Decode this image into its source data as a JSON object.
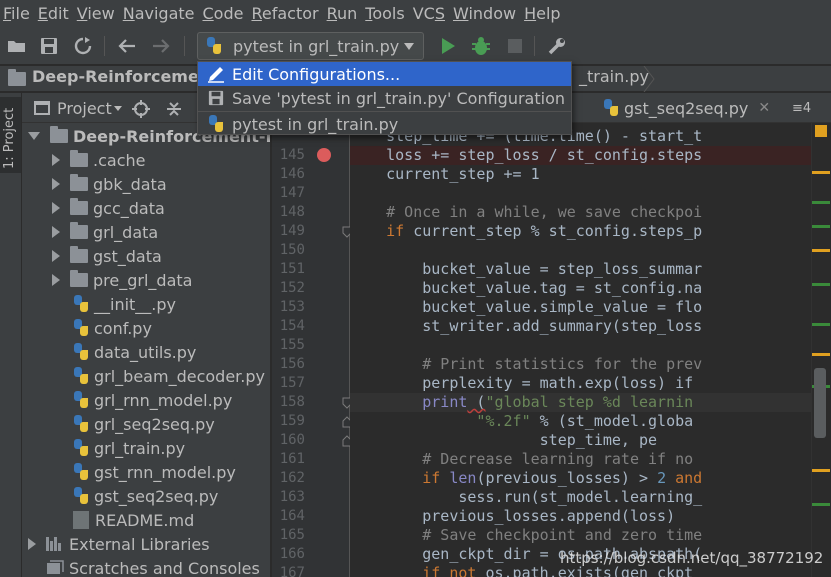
{
  "menubar": {
    "items": [
      "File",
      "Edit",
      "View",
      "Navigate",
      "Code",
      "Refactor",
      "Run",
      "Tools",
      "VCS",
      "Window",
      "Help"
    ],
    "mnemonics": [
      "F",
      "E",
      "V",
      "N",
      "C",
      "R",
      "R",
      "T",
      "S",
      "W",
      "H"
    ]
  },
  "toolbar": {
    "run_config_label": "pytest in grl_train.py",
    "icons": [
      "open-folder-icon",
      "save-icon",
      "sync-icon",
      "back-arrow-icon",
      "forward-arrow-icon",
      "run-icon",
      "debug-icon",
      "stop-icon",
      "wrench-icon"
    ]
  },
  "navbar": {
    "project_crumb": "Deep-Reinforceme",
    "file_crumb": "_train.py"
  },
  "left_stripe": {
    "tab_label": "1: Project"
  },
  "project_panel": {
    "title": "Project",
    "root": "Deep-Reinforcement-L",
    "folders": [
      ".cache",
      "gbk_data",
      "gcc_data",
      "grl_data",
      "gst_data",
      "pre_grl_data"
    ],
    "files": [
      "__init__.py",
      "conf.py",
      "data_utils.py",
      "grl_beam_decoder.py",
      "grl_rnn_model.py",
      "grl_seq2seq.py",
      "grl_train.py",
      "gst_rnn_model.py",
      "gst_seq2seq.py"
    ],
    "readme": "README.md",
    "external": "External Libraries",
    "scratches": "Scratches and Consoles"
  },
  "editor_tabs": {
    "tab1": "gst_seq2seq.py",
    "tab_count": "≡4"
  },
  "popup": {
    "items": [
      "Edit Configurations...",
      "Save 'pytest in grl_train.py' Configuration",
      "pytest in grl_train.py"
    ]
  },
  "gutter": {
    "lines": [
      "",
      "145",
      "146",
      "147",
      "148",
      "149",
      "150",
      "151",
      "152",
      "153",
      "154",
      "155",
      "156",
      "157",
      "158",
      "159",
      "160",
      "161",
      "162",
      "163",
      "164",
      "165",
      "166",
      "167"
    ]
  },
  "code": {
    "l144": "    step_time += (time.time() - start_t",
    "l145": "    loss += step_loss / st_config.steps",
    "l146": "    current_step += 1",
    "l148": "    # Once in a while, we save checkpoi",
    "l149_kw": "    if",
    "l149": " current_step % st_config.steps_p",
    "l151": "        bucket_value = step_loss_summar",
    "l152": "        bucket_value.tag = st_config.na",
    "l153": "        bucket_value.simple_value = flo",
    "l154": "        st_writer.add_summary(step_loss",
    "l156": "        # Print statistics for the prev",
    "l157": "        perplexity = math.exp(loss) if",
    "l158_kw": "        print",
    "l158_p": " (",
    "l158_s": "\"global step %d learnin",
    "l159_s": "              \"%.2f\"",
    "l159": " % (st_model.globa",
    "l160": "                     step_time, pe",
    "l161": "        # Decrease learning rate if no",
    "l162_kw": "        if",
    "l162_b": " len",
    "l162": "(previous_losses) > ",
    "l162_n": "2",
    "l162_a": " and",
    "l163": "            sess.run(st_model.learning_",
    "l164": "        previous_losses.append(loss)",
    "l165": "        # Save checkpoint and zero time",
    "l166": "        gen_ckpt_dir = os.path.abspath(",
    "l167_kw": "        if not",
    "l167": " os.path.exists(gen_ckpt_"
  },
  "watermark": "https://blog.csdn.net/qq_38772192",
  "colors": {
    "accent": "#2f65ca",
    "background": "#2b2b2b",
    "panel": "#3c3f41",
    "breakpoint": "#db5c5c",
    "run_green": "#499c54"
  }
}
